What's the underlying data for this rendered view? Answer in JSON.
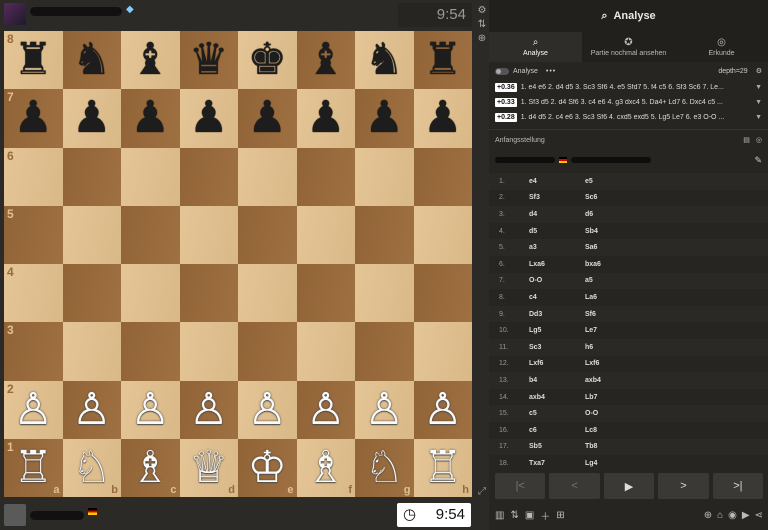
{
  "top_player": {
    "clock": "9:54",
    "icon": "diamond-icon"
  },
  "bottom_player": {
    "clock": "9:54"
  },
  "board": {
    "ranks": [
      "8",
      "7",
      "6",
      "5",
      "4",
      "3",
      "2",
      "1"
    ],
    "files": [
      "a",
      "b",
      "c",
      "d",
      "e",
      "f",
      "g",
      "h"
    ],
    "rows": [
      [
        "♜",
        "♞",
        "♝",
        "♛",
        "♚",
        "♝",
        "♞",
        "♜"
      ],
      [
        "♟",
        "♟",
        "♟",
        "♟",
        "♟",
        "♟",
        "♟",
        "♟"
      ],
      [
        "",
        "",
        "",
        "",
        "",
        "",
        "",
        ""
      ],
      [
        "",
        "",
        "",
        "",
        "",
        "",
        "",
        ""
      ],
      [
        "",
        "",
        "",
        "",
        "",
        "",
        "",
        ""
      ],
      [
        "",
        "",
        "",
        "",
        "",
        "",
        "",
        ""
      ],
      [
        "♙",
        "♙",
        "♙",
        "♙",
        "♙",
        "♙",
        "♙",
        "♙"
      ],
      [
        "♖",
        "♘",
        "♗",
        "♕",
        "♔",
        "♗",
        "♘",
        "♖"
      ]
    ]
  },
  "panel": {
    "title": "Analyse",
    "tabs": [
      "Analyse",
      "Partie nochmal ansehen",
      "Erkunde"
    ],
    "engine_label": "Analyse",
    "more": "•••",
    "depth": "depth=29",
    "lines": [
      {
        "score": "+0.36",
        "text": "1. e4 e6 2. d4 d5 3. Sc3 Sf6 4. e5 Sfd7 5. f4 c5 6. Sf3 Sc6 7. Le..."
      },
      {
        "score": "+0.33",
        "text": "1. Sf3 d5 2. d4 Sf6 3. c4 e6 4. g3 dxc4 5. Da4+ Ld7 6. Dxc4 c5 ..."
      },
      {
        "score": "+0.28",
        "text": "1. d4 d5 2. c4 e6 3. Sc3 Sf6 4. cxd5 exd5 5. Lg5 Le7 6. e3 O-O ..."
      }
    ],
    "start_position": "Anfangsstellung",
    "moves": [
      [
        "1.",
        "e4",
        "e5"
      ],
      [
        "2.",
        "Sf3",
        "Sc6"
      ],
      [
        "3.",
        "d4",
        "d6"
      ],
      [
        "4.",
        "d5",
        "Sb4"
      ],
      [
        "5.",
        "a3",
        "Sa6"
      ],
      [
        "6.",
        "Lxa6",
        "bxa6"
      ],
      [
        "7.",
        "O-O",
        "a5"
      ],
      [
        "8.",
        "c4",
        "La6"
      ],
      [
        "9.",
        "Dd3",
        "Sf6"
      ],
      [
        "10.",
        "Lg5",
        "Le7"
      ],
      [
        "11.",
        "Sc3",
        "h6"
      ],
      [
        "12.",
        "Lxf6",
        "Lxf6"
      ],
      [
        "13.",
        "b4",
        "axb4"
      ],
      [
        "14.",
        "axb4",
        "Lb7"
      ],
      [
        "15.",
        "c5",
        "O-O"
      ],
      [
        "16.",
        "c6",
        "Lc8"
      ],
      [
        "17.",
        "Sb5",
        "Tb8"
      ],
      [
        "18.",
        "Txa7",
        "Lg4"
      ]
    ],
    "controls": [
      "|<",
      "<",
      "▶",
      ">",
      ">|"
    ]
  }
}
